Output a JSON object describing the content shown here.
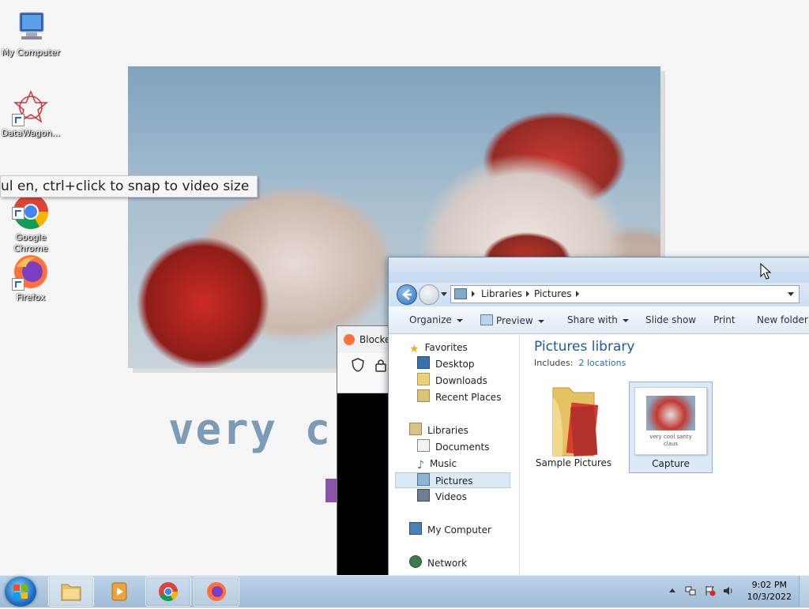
{
  "desktop": {
    "icons": [
      {
        "label": "My Computer"
      },
      {
        "label": "DataWagon..."
      },
      {
        "label": "Google\nChrome"
      },
      {
        "label": "Firefox"
      }
    ],
    "tooltip": "ul      en, ctrl+click to snap to video size",
    "wallpaper_text": "very c"
  },
  "firefox_window": {
    "tab_label": "Blocke"
  },
  "explorer": {
    "breadcrumb": [
      "Libraries",
      "Pictures"
    ],
    "toolbar": {
      "organize": "Organize",
      "preview": "Preview",
      "share_with": "Share with",
      "slide_show": "Slide show",
      "print": "Print",
      "new_folder": "New folder"
    },
    "nav": {
      "favorites": "Favorites",
      "desktop": "Desktop",
      "downloads": "Downloads",
      "recent_places": "Recent Places",
      "libraries": "Libraries",
      "documents": "Documents",
      "music": "Music",
      "pictures": "Pictures",
      "videos": "Videos",
      "my_computer": "My Computer",
      "network": "Network"
    },
    "content": {
      "title": "Pictures library",
      "includes_label": "Includes:",
      "includes_link": "2 locations",
      "items": [
        {
          "label": "Sample Pictures"
        },
        {
          "label": "Capture",
          "thumb_text": "very cool santy claus"
        }
      ]
    }
  },
  "taskbar": {
    "time": "9:02 PM",
    "date": "10/3/2022"
  }
}
